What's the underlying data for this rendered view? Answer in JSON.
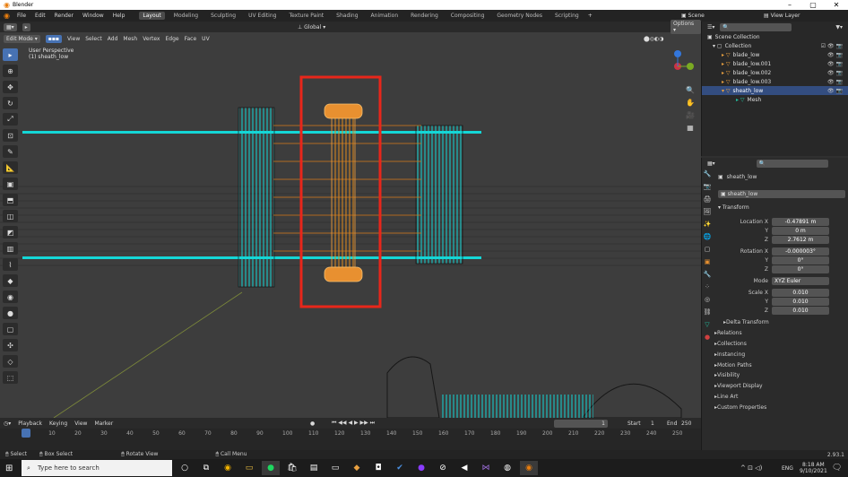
{
  "titlebar": {
    "title": "Blender",
    "minimize": "–",
    "maximize": "▢",
    "close": "✕"
  },
  "menu": {
    "items": [
      "File",
      "Edit",
      "Render",
      "Window",
      "Help"
    ],
    "workspaces": [
      "Layout",
      "Modeling",
      "Sculpting",
      "UV Editing",
      "Texture Paint",
      "Shading",
      "Animation",
      "Rendering",
      "Compositing",
      "Geometry Nodes",
      "Scripting"
    ],
    "scene": "Scene",
    "view_layer": "View Layer"
  },
  "header": {
    "mode": "Edit Mode",
    "menus": [
      "View",
      "Select",
      "Add",
      "Mesh",
      "Vertex",
      "Edge",
      "Face",
      "UV"
    ],
    "orientation": "Global",
    "options": "Options"
  },
  "viewport": {
    "perspective": "User Perspective",
    "object": "(1) sheath_low"
  },
  "timeline": {
    "menus": [
      "Playback",
      "Keying",
      "View",
      "Marker"
    ],
    "current": "1",
    "start_label": "Start",
    "start": "1",
    "end_label": "End",
    "end": "250",
    "ticks": [
      "1",
      "10",
      "20",
      "30",
      "40",
      "50",
      "60",
      "70",
      "80",
      "90",
      "100",
      "110",
      "120",
      "130",
      "140",
      "150",
      "160",
      "170",
      "180",
      "190",
      "200",
      "210",
      "220",
      "230",
      "240",
      "250"
    ]
  },
  "status": {
    "select": "Select",
    "box_select": "Box Select",
    "rotate": "Rotate View",
    "call_menu": "Call Menu",
    "version": "2.93.1"
  },
  "outliner": {
    "root": "Scene Collection",
    "collection": "Collection",
    "items": [
      "blade_low",
      "blade_low.001",
      "blade_low.002",
      "blade_low.003",
      "sheath_low"
    ],
    "mesh": "Mesh"
  },
  "properties": {
    "object_name": "sheath_low",
    "data_name": "sheath_low",
    "transform": "Transform",
    "location": {
      "label": "Location X",
      "x": "-0.47891 m",
      "y": "0 m",
      "z": "2.7612 m"
    },
    "rotation": {
      "label": "Rotation X",
      "x": "-0.000003°",
      "y": "0°",
      "z": "0°"
    },
    "mode": {
      "label": "Mode",
      "value": "XYZ Euler"
    },
    "scale": {
      "label": "Scale X",
      "x": "0.010",
      "y": "0.010",
      "z": "0.010"
    },
    "sub_y": "Y",
    "sub_z": "Z",
    "delta": "Delta Transform",
    "panels": [
      "Relations",
      "Collections",
      "Instancing",
      "Motion Paths",
      "Visibility",
      "Viewport Display",
      "Line Art",
      "Custom Properties"
    ]
  },
  "taskbar": {
    "search_placeholder": "Type here to search",
    "time": "8:18 AM",
    "date": "9/10/2021",
    "lang": "ENG"
  }
}
